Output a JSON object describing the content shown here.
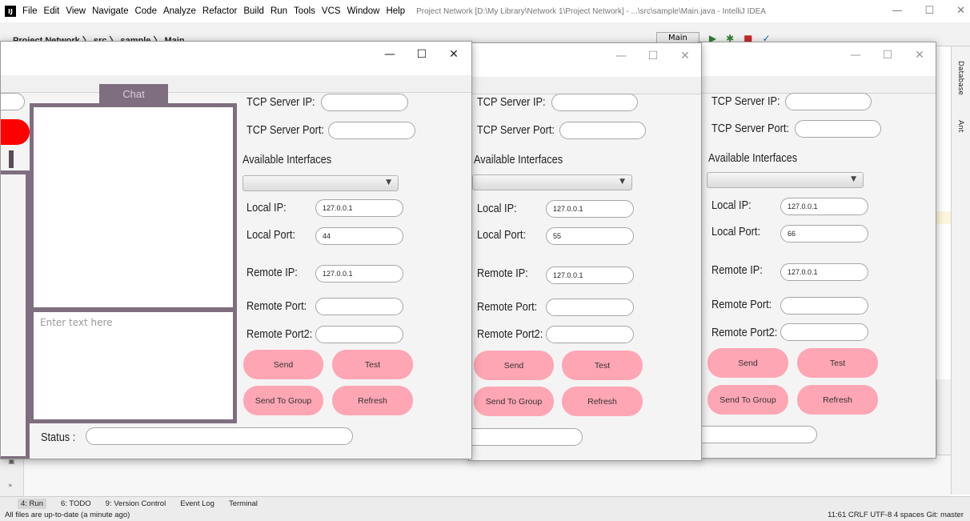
{
  "ide": {
    "menu": [
      "File",
      "Edit",
      "View",
      "Navigate",
      "Code",
      "Analyze",
      "Refactor",
      "Build",
      "Run",
      "Tools",
      "VCS",
      "Window",
      "Help"
    ],
    "title": "Project Network [D:\\My Library\\Network 1\\Project Network] - ...\\src\\sample\\Main.java - IntelliJ IDEA",
    "breadcrumb": "Project Network 〉 src 〉 sample 〉 Main",
    "run_config": "Main",
    "right_tabs": {
      "database": "Database",
      "ant": "Ant"
    },
    "toolwindows": [
      "4: Run",
      "6: TODO",
      "9: Version Control",
      "Event Log",
      "Terminal"
    ],
    "status_left": "All files are up-to-date (a minute ago)",
    "status_right": "11:61  CRLF  UTF-8  4 spaces  Git: master"
  },
  "windows": [
    {
      "chat_header": "Chat",
      "chat_placeholder": "Enter text here",
      "status_label": "Status :",
      "status_value": "",
      "tcp_ip_label": "TCP Server IP:",
      "tcp_ip_value": "",
      "tcp_port_label": "TCP Server Port:",
      "tcp_port_value": "",
      "interfaces_label": "Available Interfaces",
      "interface_selected": "",
      "local_ip_label": "Local IP:",
      "local_ip_value": "127.0.0.1",
      "local_port_label": "Local Port:",
      "local_port_value": "44",
      "remote_ip_label": "Remote IP:",
      "remote_ip_value": "127.0.0.1",
      "remote_port_label": "Remote Port:",
      "remote_port_value": "",
      "remote_port2_label": "Remote Port2:",
      "remote_port2_value": "",
      "send": "Send",
      "test": "Test",
      "send_group": "Send To Group",
      "refresh": "Refresh"
    },
    {
      "tcp_ip_label": "TCP Server IP:",
      "tcp_ip_value": "",
      "tcp_port_label": "TCP Server Port:",
      "tcp_port_value": "",
      "interfaces_label": "Available Interfaces",
      "interface_selected": "",
      "local_ip_label": "Local IP:",
      "local_ip_value": "127.0.0.1",
      "local_port_label": "Local Port:",
      "local_port_value": "55",
      "remote_ip_label": "Remote IP:",
      "remote_ip_value": "127.0.0.1",
      "remote_port_label": "Remote Port:",
      "remote_port_value": "",
      "remote_port2_label": "Remote Port2:",
      "remote_port2_value": "",
      "send": "Send",
      "test": "Test",
      "send_group": "Send To Group",
      "refresh": "Refresh"
    },
    {
      "tcp_ip_label": "TCP Server IP:",
      "tcp_ip_value": "",
      "tcp_port_label": "TCP Server Port:",
      "tcp_port_value": "",
      "interfaces_label": "Available Interfaces",
      "interface_selected": "",
      "local_ip_label": "Local IP:",
      "local_ip_value": "127.0.0.1",
      "local_port_label": "Local Port:",
      "local_port_value": "66",
      "remote_ip_label": "Remote IP:",
      "remote_ip_value": "127.0.0.1",
      "remote_port_label": "Remote Port:",
      "remote_port_value": "",
      "remote_port2_label": "Remote Port2:",
      "remote_port2_value": "",
      "send": "Send",
      "test": "Test",
      "send_group": "Send To Group",
      "refresh": "Refresh"
    }
  ],
  "window_controls": {
    "minimize": "—",
    "maximize": "☐",
    "close": "✕"
  },
  "colors": {
    "chat_border": "#7f6e7f",
    "button_pink": "#fea6b4",
    "alert_red": "#ff0000"
  }
}
